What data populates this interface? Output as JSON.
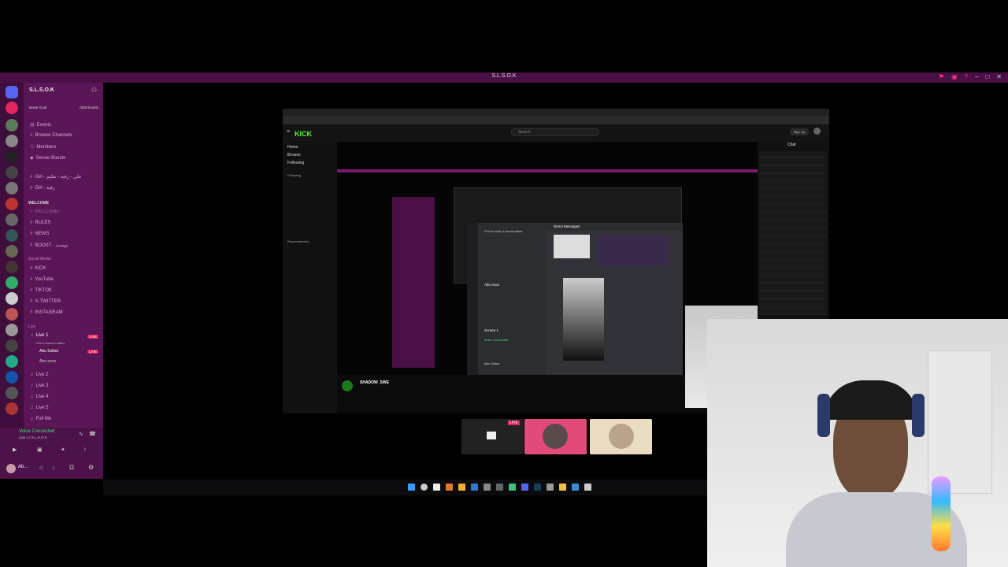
{
  "window": {
    "title": "S.L.S.O.K"
  },
  "discord": {
    "server_name": "S.L.S.O.K",
    "boost_goal": "Boost Goal",
    "boost_count": "0/28 Boosts",
    "menu": [
      "Events",
      "Browse Channels",
      "Members",
      "Server Boosts"
    ],
    "channels_top": [
      "Girl - علي - رقية - تقليم",
      "Girl - رقية"
    ],
    "category_welcome": "WELCOME",
    "welcome_channels": [
      "WELCOME",
      "RULES",
      "NEWS",
      "BOOST - بوست"
    ],
    "category_social": "Social Media",
    "social_channels": [
      "KICK",
      "YouTube",
      "TIKTOK",
      "X-TWITTER",
      "INSTAGRAM"
    ],
    "category_live": "Live",
    "live_channel": "Live 1",
    "live_subtitle": "Set a channel status",
    "live_badge": "LIVE",
    "live_users": [
      "Abu Sultan",
      "Abo sooo"
    ],
    "other_voice": [
      "Live 2",
      "Live 3",
      "Live 4",
      "Live 5",
      "Full Me"
    ],
    "voice_connected": "Voice Connected",
    "voice_channel": "Live 1 / S.L.S.O.K",
    "user_name": "Ab..."
  },
  "kick": {
    "logo": "KICK",
    "search_placeholder": "Search",
    "nav": [
      "Home",
      "Browse",
      "Following"
    ],
    "following_label": "Following",
    "recommended_label": "Recommended",
    "streamer": "SHADOW_SWE",
    "chat_label": "Chat",
    "login": "Sign Up"
  },
  "dm": {
    "header": "Direct Messages",
    "search": "Find or start a conversation",
    "friend": "Abo sooo",
    "screen": "Screen 1",
    "voice": "Voice Connected",
    "user": "Abu Sultan"
  },
  "tiles": {
    "live_badge": "LIVE"
  },
  "colors": {
    "accent": "#5a1656",
    "kick_green": "#53fc18",
    "live_red": "#e0245e"
  }
}
